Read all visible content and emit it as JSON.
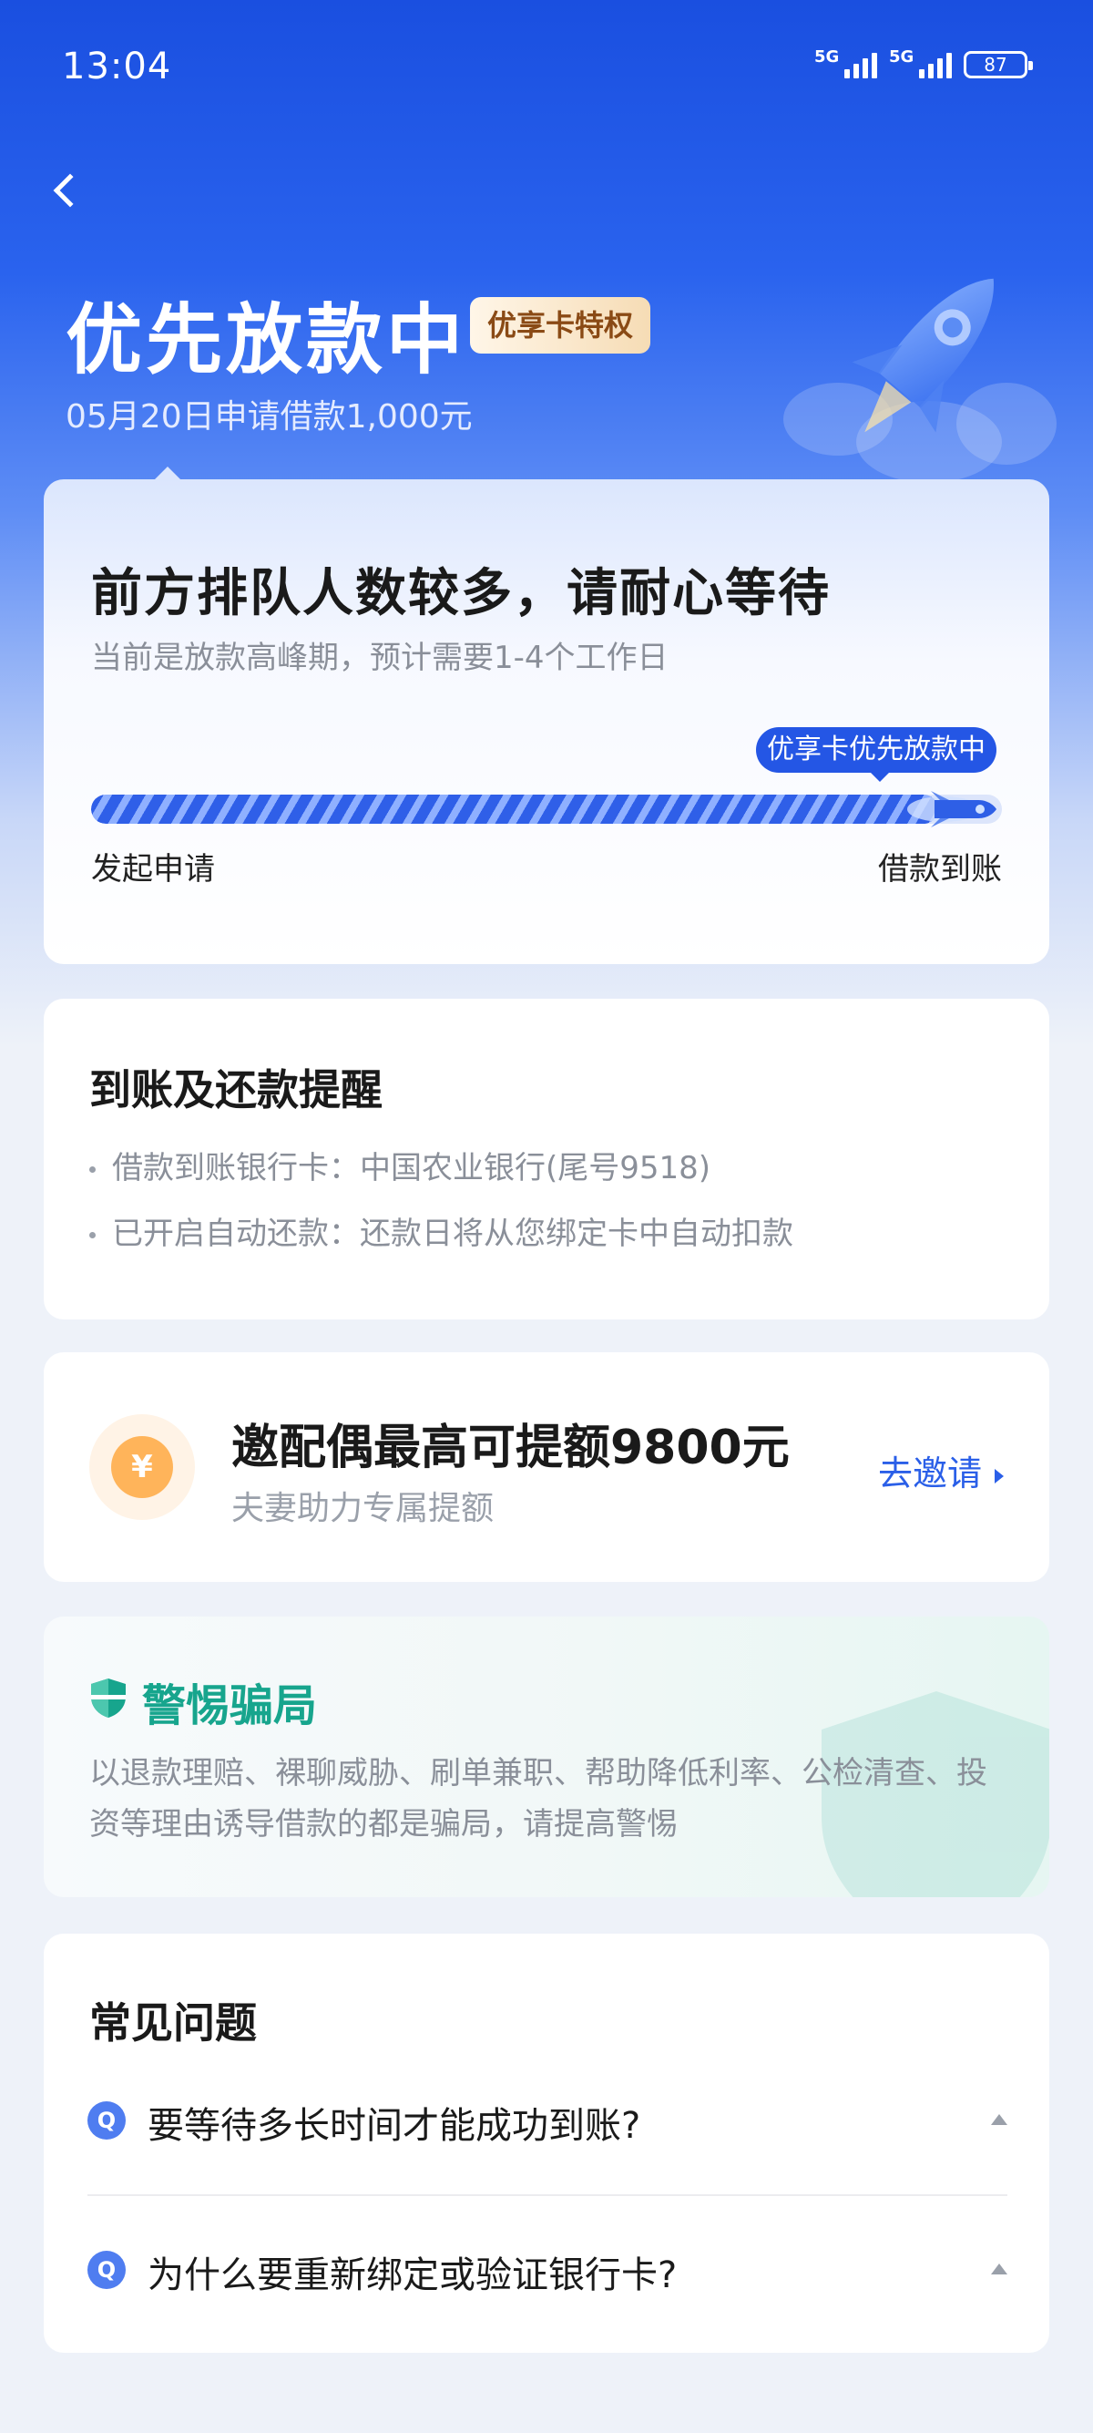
{
  "status_bar": {
    "time": "13:04",
    "signal_1": "5G",
    "signal_2": "5G",
    "battery": "87"
  },
  "header": {
    "title": "优先放款中",
    "vip_tag": "优享卡特权",
    "subtitle": "05月20日申请借款1,000元"
  },
  "progress_card": {
    "heading": "前方排队人数较多，请耐心等待",
    "sub": "当前是放款高峰期，预计需要1-4个工作日",
    "tag": "优享卡优先放款中",
    "progress": 0.93,
    "start_label": "发起申请",
    "end_label": "借款到账"
  },
  "reminder_card": {
    "title": "到账及还款提醒",
    "lines": [
      "借款到账银行卡：中国农业银行(尾号9518)",
      "已开启自动还款：还款日将从您绑定卡中自动扣款"
    ]
  },
  "invite_card": {
    "coin_symbol": "¥",
    "title": "邀配偶最高可提额9800元",
    "sub": "夫妻助力专属提额",
    "button": "去邀请"
  },
  "fraud_card": {
    "title": "警惕骗局",
    "text": "以退款理赔、裸聊威胁、刷单兼职、帮助降低利率、公检清查、投资等理由诱导借款的都是骗局，请提高警惕"
  },
  "faq_card": {
    "title": "常见问题",
    "q_badge": "Q",
    "items": [
      "要等待多长时间才能成功到账?",
      "为什么要重新绑定或验证银行卡?"
    ]
  },
  "colors": {
    "primary_blue": "#2456e5",
    "fraud_green": "#17a58d",
    "vip_brown": "#8a4a15"
  }
}
